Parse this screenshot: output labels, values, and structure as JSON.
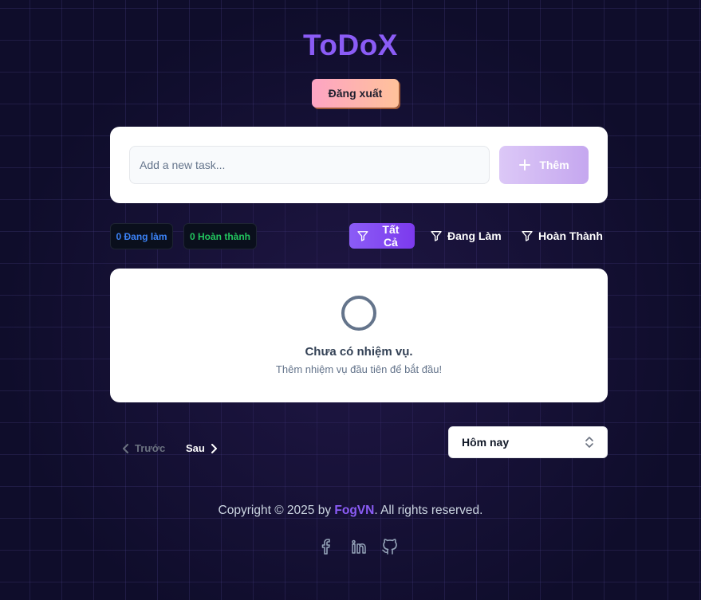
{
  "app": {
    "title": "ToDoX"
  },
  "header": {
    "logout_label": "Đăng xuất"
  },
  "add_task": {
    "placeholder": "Add a new task...",
    "add_label": "Thêm"
  },
  "stats": {
    "active": "0 Đang làm",
    "done": "0 Hoàn thành"
  },
  "filters": {
    "all": "Tất Cả",
    "active": "Đang Làm",
    "done": "Hoàn Thành",
    "selected": "all"
  },
  "empty_state": {
    "title": "Chưa có nhiệm vụ.",
    "subtitle": "Thêm nhiệm vụ đầu tiên để bắt đầu!"
  },
  "pagination": {
    "prev": "Trước",
    "next": "Sau"
  },
  "date_filter": {
    "selected": "Hôm nay"
  },
  "footer": {
    "prefix": "Copyright © 2025 by ",
    "brand": "FogVN",
    "suffix": ". All rights reserved."
  },
  "social": [
    "facebook-icon",
    "linkedin-icon",
    "github-icon"
  ],
  "colors": {
    "accent": "#8b5cf6",
    "active_stat": "#3b82f6",
    "done_stat": "#22c55e"
  }
}
